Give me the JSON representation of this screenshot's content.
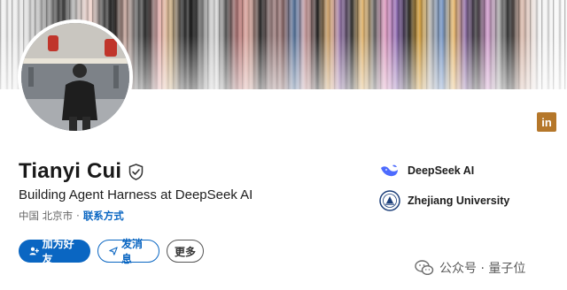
{
  "profile": {
    "name": "Tianyi Cui",
    "headline": "Building Agent Harness at DeepSeek AI",
    "location": "中国 北京市",
    "separator": "·",
    "contact_label": "联系方式"
  },
  "actions": {
    "connect_label": "加为好友",
    "message_label": "发消息",
    "more_label": "更多"
  },
  "organizations": [
    {
      "name": "DeepSeek AI",
      "icon": "deepseek-whale-icon"
    },
    {
      "name": "Zhejiang University",
      "icon": "zju-seal-icon"
    }
  ],
  "social": {
    "linkedin_label": "in"
  },
  "watermark": {
    "text": "公众号 · 量子位"
  },
  "colors": {
    "accent": "#0a66c2",
    "linkedin_badge": "#b5772a"
  }
}
